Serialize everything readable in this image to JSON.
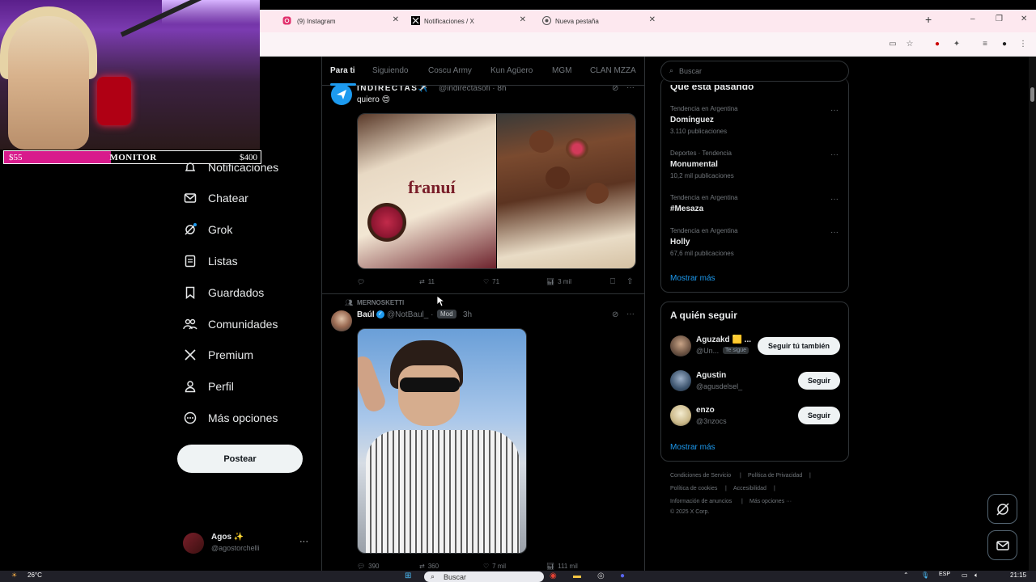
{
  "browser": {
    "tabs": [
      {
        "label": "(9) Instagram",
        "icon": "instagram-icon"
      },
      {
        "label": "Notificaciones / X",
        "icon": "x-logo-icon"
      },
      {
        "label": "Nueva pestaña",
        "icon": "chrome-icon"
      }
    ],
    "new_tab": "+",
    "window_controls": [
      "–",
      "❐",
      "✕"
    ]
  },
  "overlay": {
    "min_label": "$55",
    "title": "MONITOR",
    "max_label": "$400",
    "progress_fraction": 0.13,
    "fill_color": "#d81b8c"
  },
  "nav": {
    "items": [
      {
        "label": "Notificaciones",
        "icon": "bell-icon"
      },
      {
        "label": "Chatear",
        "icon": "mail-icon"
      },
      {
        "label": "Grok",
        "icon": "grok-icon"
      },
      {
        "label": "Listas",
        "icon": "list-icon"
      },
      {
        "label": "Guardados",
        "icon": "bookmark-icon"
      },
      {
        "label": "Comunidades",
        "icon": "people-icon"
      },
      {
        "label": "Premium",
        "icon": "x-logo-icon"
      },
      {
        "label": "Perfil",
        "icon": "person-icon"
      },
      {
        "label": "Más opciones",
        "icon": "more-circle-icon"
      }
    ],
    "post_button": "Postear",
    "account": {
      "name": "Agos ✨",
      "handle": "@agostorchelli",
      "more": "···"
    }
  },
  "timeline": {
    "tabs": [
      "Para ti",
      "Siguiendo",
      "Coscu Army",
      "Kun Agüero",
      "MGM",
      "CLAN MZZA"
    ],
    "active_tab": 0,
    "tweets": [
      {
        "name": "INDIRECTAS✈️",
        "handle": "@indirectasofi · 8h",
        "text": "quiero 😍",
        "image_brand": "franuí",
        "actions": {
          "replies": "",
          "retweets": "11",
          "likes": "71",
          "views": "3 mil"
        }
      },
      {
        "context": "MERNOSKETTI",
        "name": "Baúl",
        "handle": "@NotBaul_ ·",
        "badge": "Mod",
        "time": "3h",
        "actions": {
          "replies": "390",
          "retweets": "360",
          "likes": "7 mil",
          "views": "111 mil"
        }
      }
    ]
  },
  "sidebar": {
    "search_placeholder": "Buscar",
    "trends_title": "Qué está pasando",
    "trends": [
      {
        "meta": "Tendencia en Argentina",
        "name": "Domínguez",
        "count": "3.110 publicaciones"
      },
      {
        "meta": "Deportes · Tendencia",
        "name": "Monumental",
        "count": "10,2 mil publicaciones"
      },
      {
        "meta": "Tendencia en Argentina",
        "name": "#Mesaza",
        "count": ""
      },
      {
        "meta": "Tendencia en Argentina",
        "name": "Holly",
        "count": "67,6 mil publicaciones"
      }
    ],
    "show_more": "Mostrar más",
    "follow_title": "A quién seguir",
    "follow": [
      {
        "name": "Aguzakd 🟨 ...",
        "handle": "@Un...",
        "badge": "Te sigue",
        "button": "Seguir tú también"
      },
      {
        "name": "Agustin",
        "handle": "@agusdelsel_",
        "badge": "",
        "button": "Seguir"
      },
      {
        "name": "enzo",
        "handle": "@3nzocs",
        "badge": "",
        "button": "Seguir"
      }
    ],
    "footer": [
      "Condiciones de Servicio",
      "|",
      "Política de Privacidad",
      "|",
      "Política de cookies",
      "|",
      "Accesibilidad",
      "|",
      "Información de anuncios",
      "|",
      "Más opciones ···",
      "© 2025 X Corp."
    ]
  },
  "taskbar": {
    "weather": "26°C",
    "search": "Buscar",
    "lang": "ESP",
    "time": "21:15"
  },
  "colors": {
    "accent": "#1d9bf0",
    "background": "#000000",
    "border": "#2f3336",
    "muted": "#71767b"
  }
}
